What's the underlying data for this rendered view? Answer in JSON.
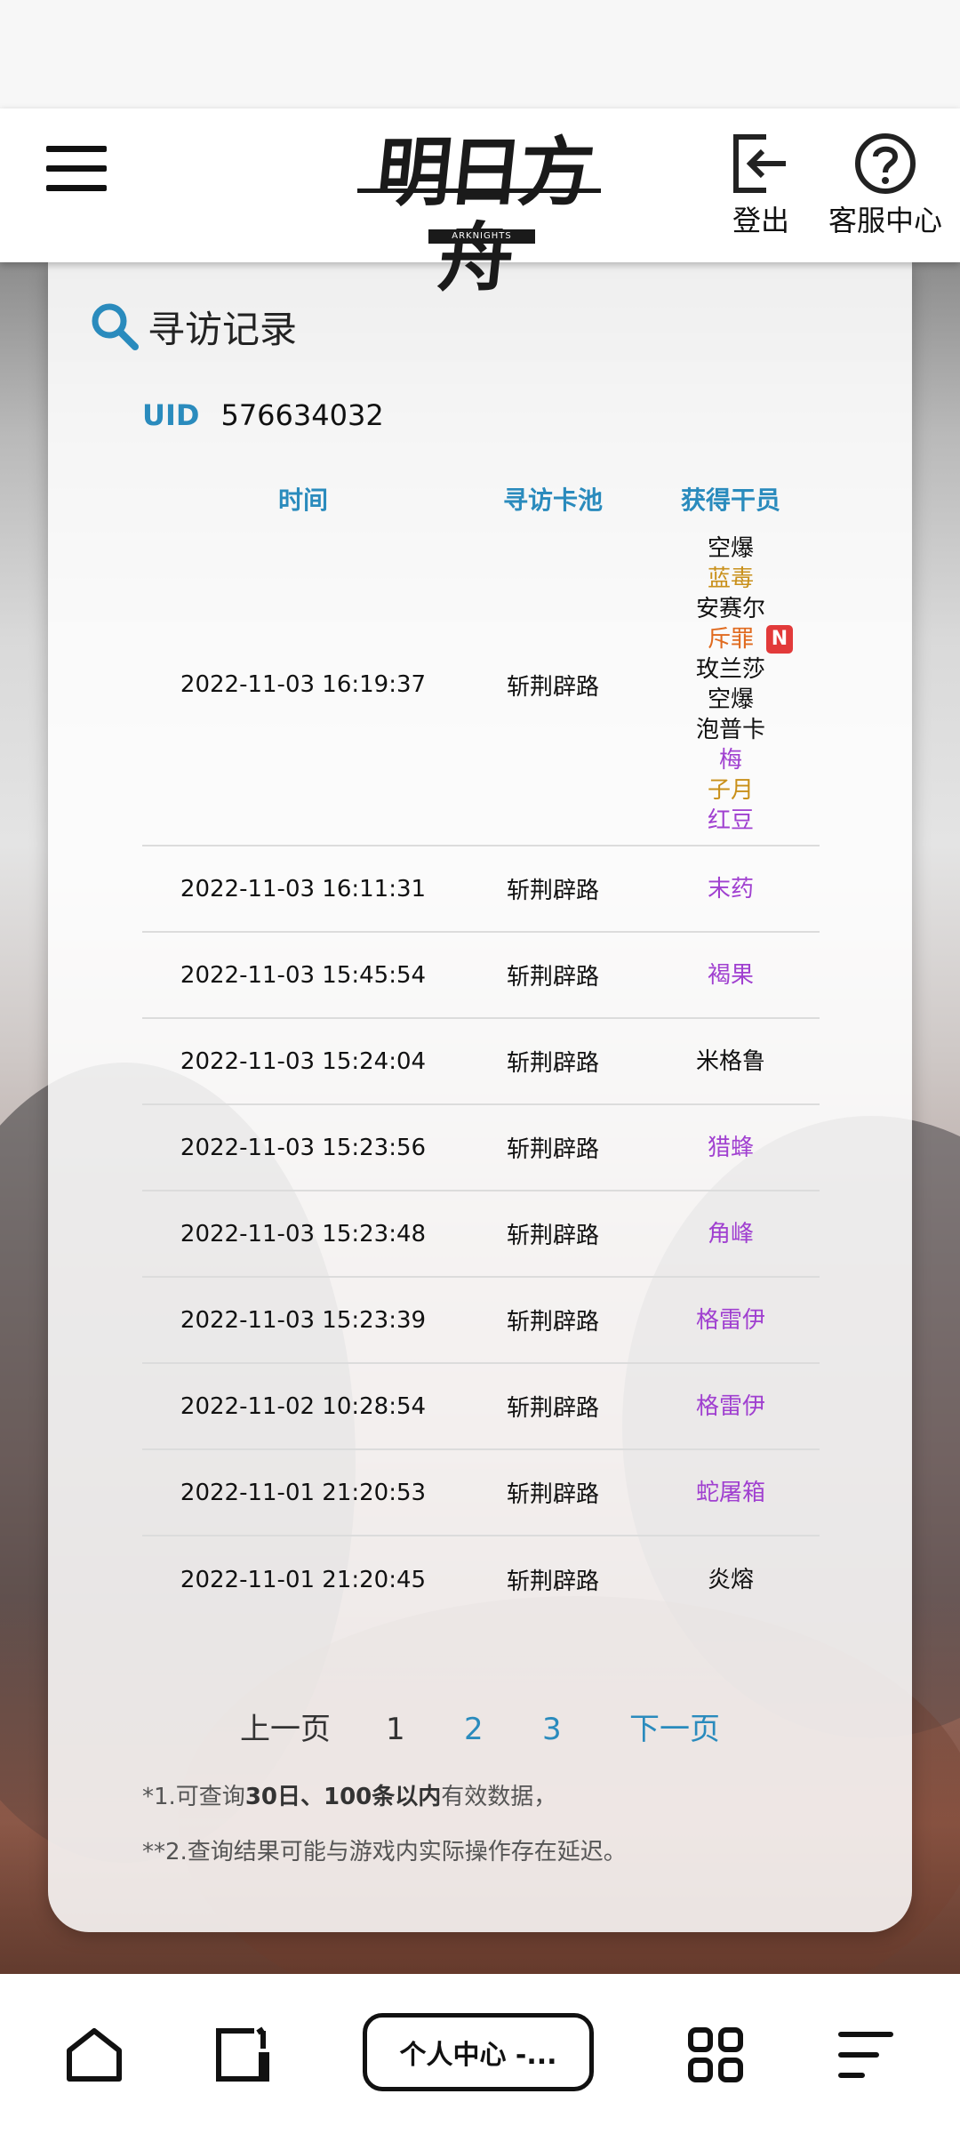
{
  "header": {
    "logo_text": "明日方舟",
    "logo_sub": "ARKNIGHTS",
    "logout_label": "登出",
    "service_label": "客服中心"
  },
  "card": {
    "title": "寻访记录",
    "uid_label": "UID",
    "uid_value": "576634032",
    "columns": [
      "时间",
      "寻访卡池",
      "获得干员"
    ]
  },
  "rows": [
    {
      "time": "2022-11-03 16:19:37",
      "pool": "斩荆辟路",
      "operators": [
        {
          "name": "空爆",
          "color": "#111111"
        },
        {
          "name": "蓝毒",
          "color": "#c9901a"
        },
        {
          "name": "安赛尔",
          "color": "#111111"
        },
        {
          "name": "斥罪",
          "color": "#e06a1e",
          "badge": "N"
        },
        {
          "name": "玫兰莎",
          "color": "#111111"
        },
        {
          "name": "空爆",
          "color": "#111111"
        },
        {
          "name": "泡普卡",
          "color": "#111111"
        },
        {
          "name": "梅",
          "color": "#a040d0"
        },
        {
          "name": "子月",
          "color": "#c9901a"
        },
        {
          "name": "红豆",
          "color": "#a040d0"
        }
      ]
    },
    {
      "time": "2022-11-03 16:11:31",
      "pool": "斩荆辟路",
      "operators": [
        {
          "name": "末药",
          "color": "#a040d0"
        }
      ]
    },
    {
      "time": "2022-11-03 15:45:54",
      "pool": "斩荆辟路",
      "operators": [
        {
          "name": "褐果",
          "color": "#a040d0"
        }
      ]
    },
    {
      "time": "2022-11-03 15:24:04",
      "pool": "斩荆辟路",
      "operators": [
        {
          "name": "米格鲁",
          "color": "#111111"
        }
      ]
    },
    {
      "time": "2022-11-03 15:23:56",
      "pool": "斩荆辟路",
      "operators": [
        {
          "name": "猎蜂",
          "color": "#a040d0"
        }
      ]
    },
    {
      "time": "2022-11-03 15:23:48",
      "pool": "斩荆辟路",
      "operators": [
        {
          "name": "角峰",
          "color": "#a040d0"
        }
      ]
    },
    {
      "time": "2022-11-03 15:23:39",
      "pool": "斩荆辟路",
      "operators": [
        {
          "name": "格雷伊",
          "color": "#a040d0"
        }
      ]
    },
    {
      "time": "2022-11-02 10:28:54",
      "pool": "斩荆辟路",
      "operators": [
        {
          "name": "格雷伊",
          "color": "#a040d0"
        }
      ]
    },
    {
      "time": "2022-11-01 21:20:53",
      "pool": "斩荆辟路",
      "operators": [
        {
          "name": "蛇屠箱",
          "color": "#a040d0"
        }
      ]
    },
    {
      "time": "2022-11-01 21:20:45",
      "pool": "斩荆辟路",
      "operators": [
        {
          "name": "炎熔",
          "color": "#111111"
        }
      ]
    }
  ],
  "pager": {
    "prev": "上一页",
    "pages": [
      "1",
      "2",
      "3"
    ],
    "current": "1",
    "next": "下一页"
  },
  "notes": {
    "note1_pre": "*1.可查询",
    "note1_bold": "30日、100条以内",
    "note1_post": "有效数据，",
    "note2": "**2.查询结果可能与游戏内实际操作存在延迟。"
  },
  "bottom_nav": {
    "center_label": "个人中心 -..."
  },
  "colors": {
    "accent": "#2a8bbd",
    "purple": "#a040d0",
    "gold": "#c9901a",
    "orange": "#e06a1e",
    "badge": "#e23a3a"
  },
  "icons": [
    "menu-icon",
    "logout-icon",
    "help-icon",
    "search-icon",
    "home-icon",
    "tab-icon",
    "apps-icon",
    "more-icon"
  ]
}
